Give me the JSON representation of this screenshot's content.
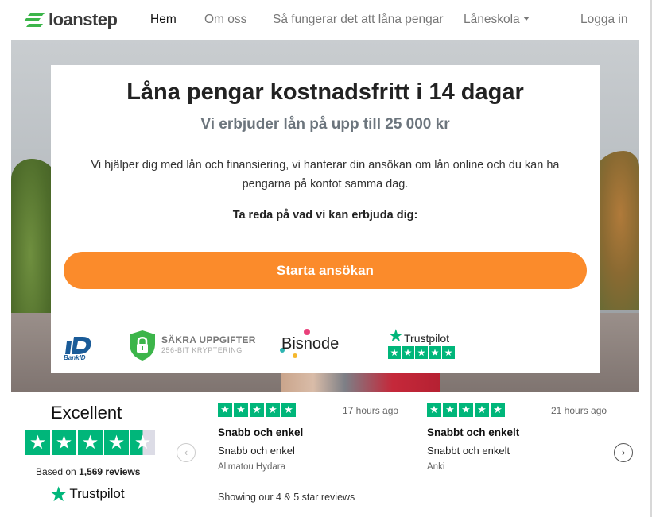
{
  "brand": {
    "name": "loanstep",
    "color": "#28a745"
  },
  "nav": {
    "items": [
      {
        "label": "Hem",
        "active": true
      },
      {
        "label": "Om oss"
      },
      {
        "label": "Så fungerar det att låna pengar"
      },
      {
        "label": "Låneskola"
      }
    ],
    "login": "Logga in"
  },
  "hero": {
    "title": "Låna pengar kostnadsfritt i 14 dagar",
    "subtitle": "Vi erbjuder lån på upp till 25 000 kr",
    "text": "Vi hjälper dig med lån och finansiering, vi hanterar din ansökan om lån online och du kan ha pengarna på kontot samma dag.",
    "prompt": "Ta reda på vad vi kan erbjuda dig:",
    "cta": "Starta ansökan",
    "cta_color": "#fb8b2b",
    "badges": {
      "bankid": "BankID",
      "sakra_title": "SÄKRA UPPGIFTER",
      "sakra_sub": "256-BIT KRYPTERING",
      "bisnode": "Bisnode",
      "trustpilot": "Trustpilot"
    }
  },
  "trustpilot": {
    "rating_label": "Excellent",
    "rating_stars": 4.5,
    "based_on_prefix": "Based on",
    "reviews_link": "1,569 reviews",
    "logo": "Trustpilot",
    "star_color": "#00b67a",
    "reviews": [
      {
        "time": "17 hours ago",
        "title": "Snabb och enkel",
        "text": "Snabb och enkel",
        "author": "Alimatou Hydara",
        "stars": 5
      },
      {
        "time": "21 hours ago",
        "title": "Snabbt och enkelt",
        "text": "Snabbt och enkelt",
        "author": "Anki",
        "stars": 5
      }
    ],
    "showing": "Showing our 4 & 5 star reviews"
  }
}
